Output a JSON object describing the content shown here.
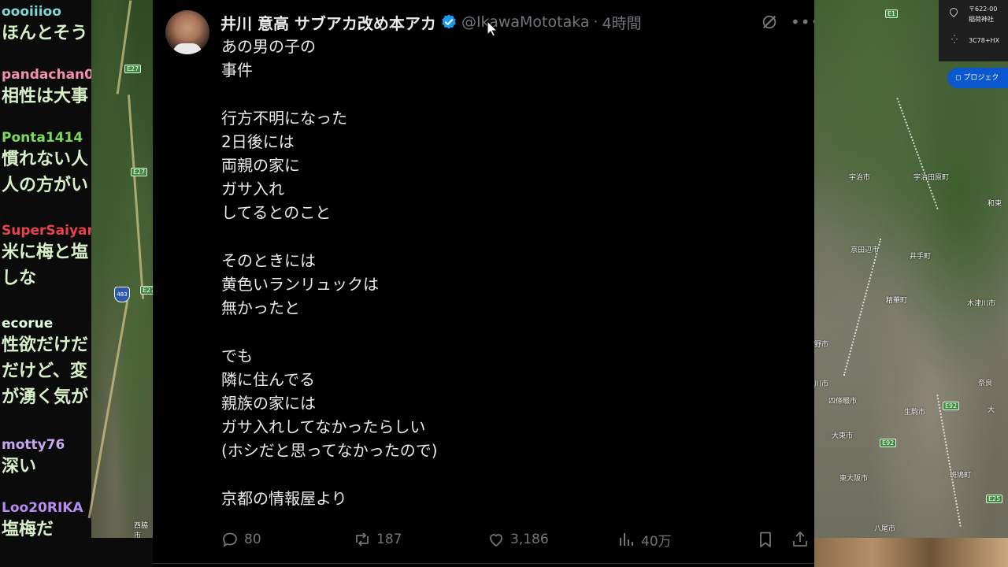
{
  "chat": [
    {
      "name": "oooiiioo",
      "color": "#7fd6d6",
      "lines": [
        "ほんとそう"
      ]
    },
    {
      "name": "pandachan0",
      "color": "#f48fb1",
      "lines": [
        "相性は大事"
      ]
    },
    {
      "name": "Ponta1414",
      "color": "#7cdc5a",
      "lines": [
        "慣れない人",
        "人の方がい"
      ]
    },
    {
      "name": "SuperSaiyan",
      "color": "#e8424a",
      "lines": [
        "米に梅と塩",
        "しな"
      ]
    },
    {
      "name": "ecorue",
      "color": "#e0ffe0",
      "lines": [
        "性欲だけだ",
        "だけど、変",
        "が湧く気が"
      ]
    },
    {
      "name": "motty76",
      "color": "#c9a6f0",
      "lines": [
        "深い"
      ]
    },
    {
      "name": "Loo20RIKA",
      "color": "#b68cf0",
      "lines": [
        "塩梅だ"
      ]
    }
  ],
  "tweet": {
    "display_name": "井川 意高 サブアカ改め本アカ",
    "handle": "@IkawaMototaka",
    "separator": "·",
    "time": "4時間",
    "text": "あの男の子の\n事件\n\n行方不明になった\n2日後には\n両親の家に\nガサ入れ\nしてるとのこと\n\nそのときには\n黄色いランリュックは\n無かったと\n\nでも\n隣に住んでる\n親族の家には\nガサ入れしてなかったらしい\n(ホシだと思ってなかったので)\n\n京都の情報屋より",
    "replies": "80",
    "reposts": "187",
    "likes": "3,186",
    "views": "40万",
    "accent": "#1d9bf0"
  },
  "map_left": {
    "labels": [
      "E27",
      "E27",
      "E27",
      "483",
      "西脇市"
    ]
  },
  "map_right": {
    "panel_address": "〒622-00",
    "panel_place": "稲荷神社",
    "panel_code": "3C78+HX",
    "project_button": "プロジェク",
    "cities": [
      "宇治市",
      "宇治田原町",
      "和束",
      "京田辺市",
      "井手町",
      "精華町",
      "木津川市",
      "野市",
      "川市",
      "四條畷市",
      "生駒市",
      "奈良",
      "大東市",
      "東大阪市",
      "斑鳩町",
      "八尾市",
      "大"
    ],
    "highways": [
      "E1",
      "E92",
      "E92",
      "E25"
    ]
  }
}
